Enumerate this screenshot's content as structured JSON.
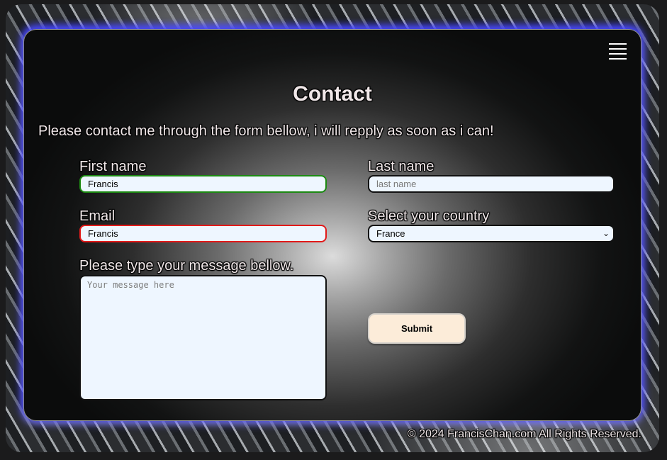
{
  "menu": {
    "icon": "hamburger-menu-icon"
  },
  "page": {
    "title": "Contact",
    "intro": "Please contact me through the form bellow, i will repply as soon as i can!"
  },
  "form": {
    "first_name": {
      "label": "First name",
      "value": "Francis",
      "status_color": "#1c8a12"
    },
    "last_name": {
      "label": "Last name",
      "placeholder": "last name"
    },
    "email": {
      "label": "Email",
      "value": "Francis",
      "status_color": "#e21a1a"
    },
    "country": {
      "label": "Select your country",
      "selected": "France",
      "icon": "chevron-down-icon"
    },
    "message": {
      "label": "Please type your message bellow.",
      "placeholder": "Your message here"
    },
    "submit_label": "Submit"
  },
  "footer": {
    "text": "© 2024 FrancisChan.com All Rights Reserved."
  },
  "colors": {
    "card_glow": "#4646ff",
    "field_bg": "#eef6ff",
    "submit_bg": "#fcecd9"
  }
}
